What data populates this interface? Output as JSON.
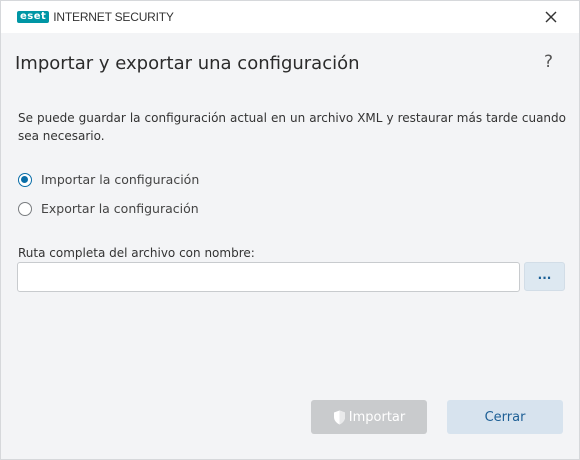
{
  "titlebar": {
    "brand_mark": "eset",
    "product_name": "INTERNET SECURITY"
  },
  "header": {
    "title": "Importar y exportar una configuración",
    "help_label": "?"
  },
  "description": "Se puede guardar la configuración actual en un archivo XML y restaurar más tarde cuando sea necesario.",
  "options": {
    "import_label": "Importar la configuración",
    "export_label": "Exportar la configuración",
    "selected": "import"
  },
  "file_path": {
    "label": "Ruta completa del archivo con nombre:",
    "value": "",
    "placeholder": "",
    "browse_label": "..."
  },
  "buttons": {
    "import_label": "Importar",
    "close_label": "Cerrar"
  },
  "colors": {
    "brand": "#0096a5",
    "accent": "#0a6ea8",
    "disabled_button": "#c9cbcd",
    "secondary_button": "#d7e3ee"
  },
  "icons": {
    "close": "close-icon",
    "help": "help-icon",
    "shield": "shield-icon"
  }
}
